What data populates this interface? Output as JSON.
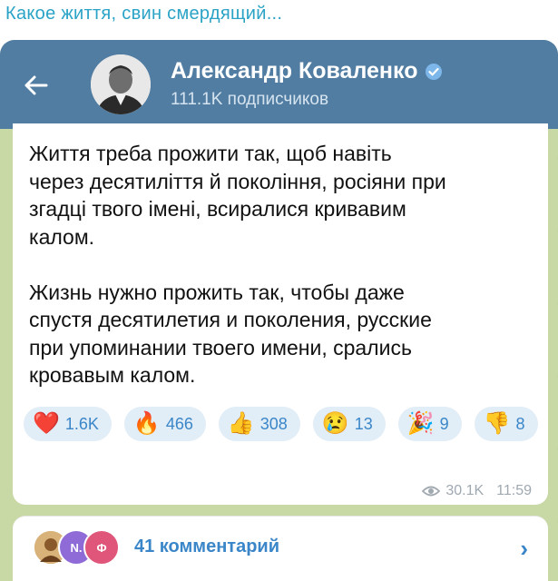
{
  "caption": "Какое життя, свин смердящий...",
  "header": {
    "channel_name": "Александр Коваленко",
    "subscribers": "111.1K подписчиков"
  },
  "post": {
    "text_uk": "Життя треба прожити так, щоб навіть\nчерез десятиліття й покоління, росіяни при\nзгадці твого імені, всиралися кривавим\nкалом.",
    "text_ru": "Жизнь нужно прожить так, чтобы даже\nспустя десятилетия и поколения, русские\nпри упоминании твоего имени, срались\nкровавым калом.",
    "reactions": [
      {
        "icon": "heart-icon",
        "emoji": "❤️",
        "count": "1.6K"
      },
      {
        "icon": "fire-icon",
        "emoji": "🔥",
        "count": "466"
      },
      {
        "icon": "thumbs-up-icon",
        "emoji": "👍",
        "count": "308"
      },
      {
        "icon": "crying-face-icon",
        "emoji": "😢",
        "count": "13"
      },
      {
        "icon": "party-popper-icon",
        "emoji": "🎉",
        "count": "9"
      },
      {
        "icon": "thumbs-down-icon",
        "emoji": "👎",
        "count": "8"
      }
    ],
    "views": "30.1K",
    "time": "11:59"
  },
  "comments": {
    "label": "41 комментарий",
    "avatars": [
      {
        "initial": "",
        "color": "#c9a26b"
      },
      {
        "initial": "N.",
        "color": "#8e6bd6"
      },
      {
        "initial": "Ф",
        "color": "#e0567a"
      }
    ]
  },
  "colors": {
    "header": "#517da2",
    "accent": "#3a86c8",
    "background": "#c9d9a6"
  }
}
